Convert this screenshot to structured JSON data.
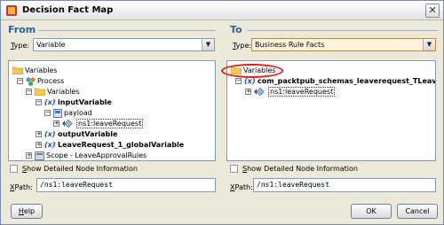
{
  "window": {
    "title": "Decision Fact Map",
    "close_glyph": "✕"
  },
  "from": {
    "header": "From",
    "type_label_u": "T",
    "type_label_rest": "ype:",
    "type_value": "Variable",
    "tree": {
      "variables": "Variables",
      "process": "Process",
      "inner_variables": "Variables",
      "input_variable": "inputVariable",
      "payload": "payload",
      "leave_request": "ns1:leaveRequest",
      "output_variable": "outputVariable",
      "global_variable": "LeaveRequest_1_globalVariable",
      "scope": "Scope - LeaveApprovalRules",
      "var_prefix": "(x)"
    },
    "show_detail_label_u": "S",
    "show_detail_label_rest": "how Detailed Node Information",
    "xpath_label_u": "X",
    "xpath_label_rest": "Path:",
    "xpath_value": "/ns1:leaveRequest"
  },
  "to": {
    "header": "To",
    "type_label_u": "T",
    "type_label_rest": "ype:",
    "type_value": "Business Rule Facts",
    "tree": {
      "variables": "Variables",
      "schema_var": "com_packtpub_schemas_leaverequest_TLeave",
      "leave_request": "ns1:leaveRequest",
      "var_prefix": "(x)"
    },
    "show_detail_label_u": "S",
    "show_detail_label_rest": "how Detailed Node Information",
    "xpath_label_u": "X",
    "xpath_label_rest": "Path:",
    "xpath_value": "/ns1:leaveRequest"
  },
  "buttons": {
    "help_u": "H",
    "help_rest": "elp",
    "ok": "OK",
    "cancel": "Cancel"
  },
  "colors": {
    "accent": "#2d5fa0",
    "highlight_ellipse": "#e02020"
  }
}
